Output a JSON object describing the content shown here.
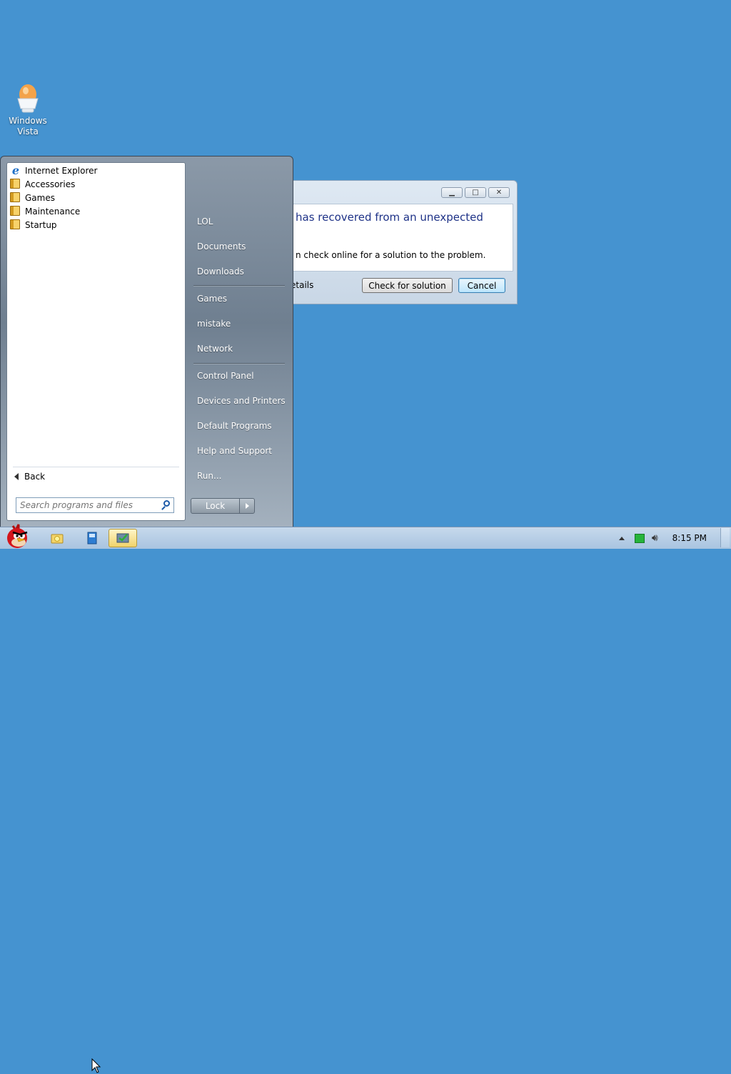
{
  "desktop": {
    "icon_label_line1": "Windows",
    "icon_label_line2": "Vista"
  },
  "dialog": {
    "headline": "has recovered from an unexpected",
    "body": "n check online for a solution to the problem.",
    "details_link": "etails",
    "check_button": "Check for solution",
    "cancel_button": "Cancel"
  },
  "start_menu": {
    "programs": [
      {
        "label": "Internet Explorer",
        "icon": "internet-explorer-icon"
      },
      {
        "label": "Accessories",
        "icon": "folder-icon"
      },
      {
        "label": "Games",
        "icon": "folder-icon"
      },
      {
        "label": "Maintenance",
        "icon": "folder-icon"
      },
      {
        "label": "Startup",
        "icon": "folder-icon"
      }
    ],
    "back_label": "Back",
    "search_placeholder": "Search programs and files",
    "right_items": {
      "lol": "LOL",
      "documents": "Documents",
      "downloads": "Downloads",
      "games": "Games",
      "mistake": "mistake",
      "network": "Network",
      "control_panel": "Control Panel",
      "devices_printers": "Devices and Printers",
      "default_programs": "Default Programs",
      "help_support": "Help and Support",
      "run": "Run..."
    },
    "lock_label": "Lock"
  },
  "taskbar": {
    "clock": "8:15 PM"
  },
  "colors": {
    "desktop": "#4593d0",
    "dialog_headline": "#1e3287",
    "taskbar": "#b8cfe7"
  }
}
